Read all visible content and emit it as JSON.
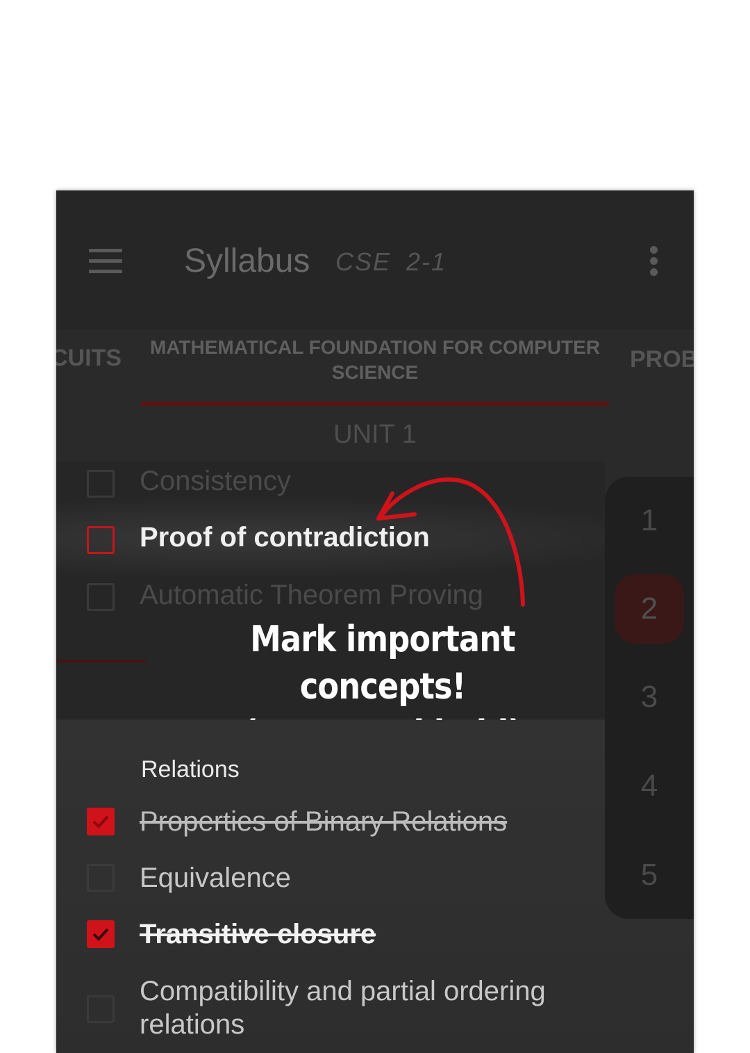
{
  "app": {
    "title": "Syllabus",
    "subtitle": "CSE  2-1",
    "menu_icon": "hamburger-menu-icon",
    "overflow_icon": "more-vertical-icon"
  },
  "tabs": {
    "left": "CUITS",
    "active": "MATHEMATICAL FOUNDATION FOR COMPUTER SCIENCE",
    "right": "PROB"
  },
  "unit_header": "UNIT 1",
  "top_items": [
    {
      "label": "Consistency",
      "checked": false
    },
    {
      "label": "Proof of contradiction",
      "checked": false,
      "highlighted": true
    },
    {
      "label": "Automatic Theorem Proving",
      "checked": false
    }
  ],
  "callout": {
    "line1": "Mark important concepts!",
    "line2": "(press and hold)"
  },
  "section": {
    "title": "Relations",
    "items": [
      {
        "label": "Properties of Binary Relations",
        "checked": true
      },
      {
        "label": "Equivalence",
        "checked": false
      },
      {
        "label": "Transitive closure",
        "checked": true
      },
      {
        "label": "Compatibility and partial ordering relations",
        "checked": false
      }
    ]
  },
  "units": [
    "1",
    "2",
    "3",
    "4",
    "5"
  ],
  "selected_unit": "2",
  "colors": {
    "accent": "#d0121a",
    "background": "#2a2a2a",
    "text": "#ffffff"
  }
}
